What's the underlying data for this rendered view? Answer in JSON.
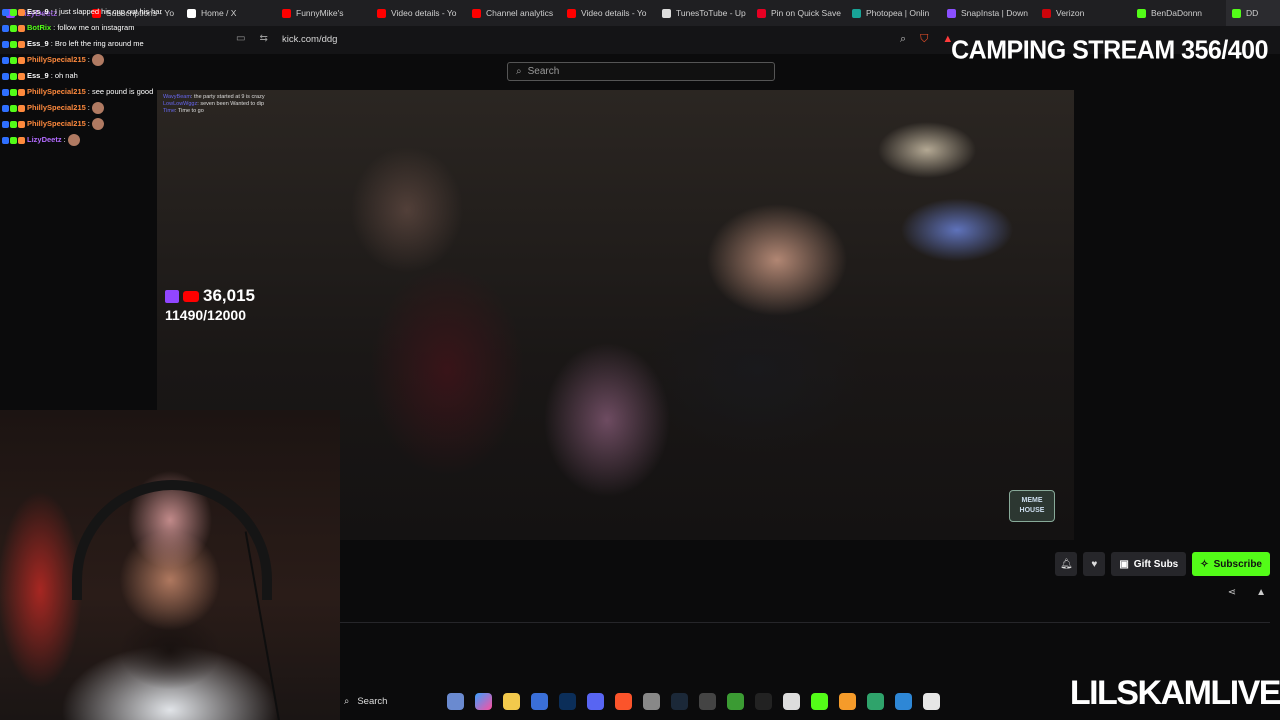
{
  "tabs": [
    {
      "label": "Subscriptions - Yo",
      "color": "#ff0000"
    },
    {
      "label": "Home / X",
      "color": "#ffffff"
    },
    {
      "label": "FunnyMike's",
      "color": "#ff0000"
    },
    {
      "label": "Video details - Yo",
      "color": "#ff0000"
    },
    {
      "label": "Channel analytics",
      "color": "#ff0000"
    },
    {
      "label": "Video details - Yo",
      "color": "#ff0000"
    },
    {
      "label": "TunesToTube - Up",
      "color": "#dddddd"
    },
    {
      "label": "Pin on Quick Save",
      "color": "#e60023"
    },
    {
      "label": "Photopea | Onlin",
      "color": "#18a497"
    },
    {
      "label": "SnapInsta | Down",
      "color": "#8a4fff"
    },
    {
      "label": "Verizon",
      "color": "#cd040b"
    },
    {
      "label": "BenDaDonnn",
      "color": "#53fc18"
    },
    {
      "label": "DD",
      "color": "#53fc18"
    }
  ],
  "address": {
    "url": "kick.com/ddg"
  },
  "search": {
    "placeholder": "Search"
  },
  "stream_title": "CAMPING STREAM 356/400",
  "brand": "LILSKAMLIVE",
  "viewers": {
    "count": "36,015",
    "goal": "11490/12000"
  },
  "watermark": "MEME HOUSE",
  "side_chat": [
    {
      "user": "Ess_9",
      "text": ": I just slapped his cup out his hand skam",
      "user_color": "#ffffff"
    },
    {
      "user": "BotRix",
      "text": ": follow me on instagram",
      "user_color": "#53fc18"
    },
    {
      "user": "Ess_9",
      "text": ": Bro left the ring around me",
      "user_color": "#ffffff"
    },
    {
      "user": "PhillySpecial215",
      "text": ":",
      "user_color": "#ff8a3d"
    },
    {
      "user": "Ess_9",
      "text": ": oh nah",
      "user_color": "#ffffff"
    },
    {
      "user": "PhillySpecial215",
      "text": ": see pound is good",
      "user_color": "#ff8a3d"
    },
    {
      "user": "PhillySpecial215",
      "text": ":",
      "user_color": "#ff8a3d"
    },
    {
      "user": "PhillySpecial215",
      "text": ":",
      "user_color": "#ff8a3d"
    },
    {
      "user": "LizyDeetz",
      "text": ":",
      "user_color": "#b36bff"
    }
  ],
  "video_chat": [
    {
      "user": "WavyBeam",
      "text": "the party started at 9 is crazy"
    },
    {
      "user": "LowLowWggz",
      "text": "seven been Wanted to dip"
    },
    {
      "user": "Time",
      "text": "Time to go"
    }
  ],
  "buttons": {
    "gift": "Gift Subs",
    "subscribe": "Subscribe"
  },
  "taskbar": {
    "search": "Search"
  },
  "colors": {
    "kick_green": "#53fc18",
    "bg": "#0b0b0c"
  }
}
